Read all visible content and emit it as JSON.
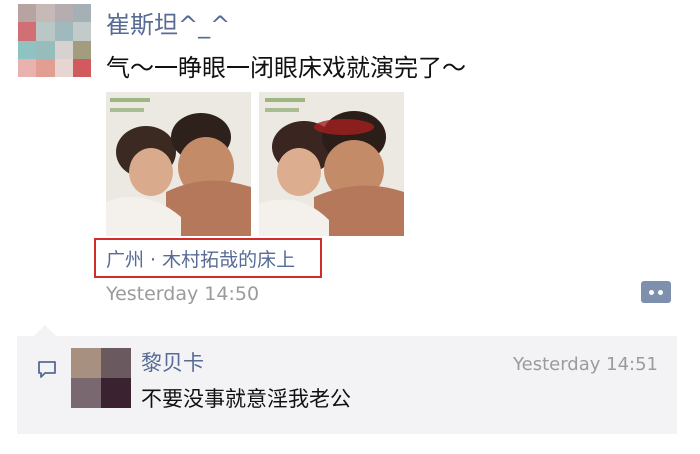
{
  "post": {
    "author": "崔斯坦^_^",
    "text": "气～一睁眼一闭眼床戏就演完了～",
    "photos": [
      "photo-1",
      "photo-2"
    ],
    "location": "广州 · 木村拓哉的床上",
    "time": "Yesterday 14:50"
  },
  "comment": {
    "author": "黎贝卡",
    "time": "Yesterday 14:51",
    "text": "不要没事就意淫我老公"
  },
  "colors": {
    "name_link": "#576b95",
    "timestamp": "#9b9b9b",
    "highlight_border": "#d12b2b",
    "comment_bg": "#f3f3f5"
  },
  "icons": {
    "more": "more-dots-icon",
    "comment": "comment-bubble-icon"
  }
}
